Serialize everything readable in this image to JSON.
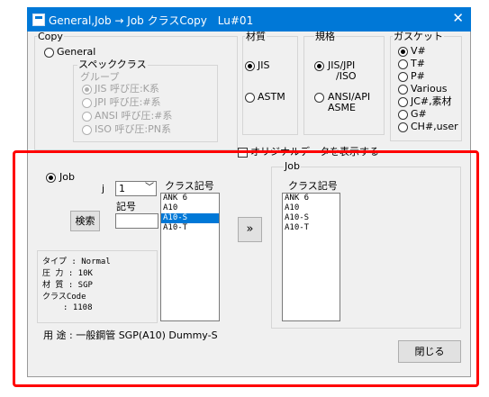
{
  "window": {
    "title": "General,Job → Job クラスCopy　Lu#01",
    "close": "✕"
  },
  "copy": {
    "label": "Copy",
    "general": "General",
    "spec_class": "スペッククラス",
    "group": "グループ",
    "jis": "JIS 呼び圧:K系",
    "jpi": "JPI 呼び圧:#系",
    "ansi": "ANSI 呼び圧:#系",
    "iso": "ISO 呼び圧:PN系"
  },
  "material": {
    "label": "材質",
    "jis": "JIS",
    "astm": "ASTM"
  },
  "standard": {
    "label": "規格",
    "jis_jpi_line1": "JIS/JPI",
    "jis_jpi_line2": "/ISO",
    "ansi_line1": "ANSI/API",
    "ansi_line2": "ASME"
  },
  "gasket": {
    "label": "ガスケット",
    "options": [
      "V#",
      "T#",
      "P#",
      "Various",
      "JC#,素材",
      "G#",
      "CH#,user"
    ]
  },
  "checkbox_label": "オリジナルデータを表示する",
  "job": {
    "radio_label": "Job",
    "j_label": "j",
    "j_value": "1",
    "class_header": "クラス記号",
    "symbol_label": "記号",
    "symbol_value": "",
    "search_button": "検索",
    "class_list": [
      "ANK 6",
      "A10",
      "A10-S",
      "A10-T"
    ],
    "selected": "A10-S"
  },
  "info": {
    "type": "タイプ  : Normal",
    "pressure": "圧  力  : 10K",
    "material": "材  質  : SGP",
    "classcode_label": "クラスCode",
    "classcode_value": ": 1108"
  },
  "usage": "用  途 : 一般鋼管 SGP(A10) Dummy-S",
  "copy_button": "»",
  "job_target": {
    "label": "Job",
    "class_header": "クラス記号",
    "class_list": [
      "ANK 6",
      "A10",
      "A10-S",
      "A10-T"
    ]
  },
  "close_button": "閉じる"
}
